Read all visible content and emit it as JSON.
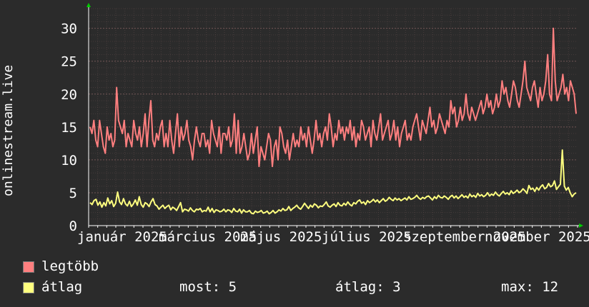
{
  "chart_data": {
    "type": "line",
    "ylabel": "onlinestream.live",
    "ylim": [
      0,
      33
    ],
    "y_ticks": [
      0,
      5,
      10,
      15,
      20,
      25,
      30
    ],
    "x_tick_labels": [
      "január 2025",
      "március 2025",
      "május 2025",
      "július 2025",
      "szeptember 2025",
      "november 2025"
    ],
    "grid": true,
    "legend_placement": "bottom-left",
    "colors": {
      "background": "#2b2b2b",
      "plot_background": "#2b2b2b",
      "grid": "#5a4848",
      "axis": "#ffffff",
      "arrow": "#00cc00",
      "max_series": "#ff7f7f",
      "avg_series": "#ffff7f"
    },
    "series": [
      {
        "name": "legtöbb",
        "values": [
          15,
          14,
          16,
          13,
          12,
          16,
          14,
          12,
          11,
          15,
          13,
          14,
          12,
          13,
          21,
          16,
          15,
          14,
          16,
          12,
          14,
          13,
          12,
          16,
          14,
          13,
          15,
          12,
          14,
          17,
          12,
          16,
          19,
          13,
          12,
          14,
          13,
          15,
          16,
          12,
          14,
          12,
          16,
          13,
          11,
          14,
          17,
          12,
          15,
          13,
          14,
          16,
          13,
          12,
          10,
          13,
          15,
          13,
          12,
          14,
          14,
          12,
          13,
          11,
          16,
          14,
          13,
          12,
          15,
          11,
          14,
          14,
          13,
          15,
          12,
          13,
          17,
          11,
          16,
          11,
          12,
          14,
          12,
          10,
          11,
          14,
          11,
          13,
          15,
          9,
          12,
          11,
          10,
          12,
          14,
          13,
          9,
          12,
          13,
          10,
          15,
          14,
          12,
          11,
          13,
          10,
          12,
          14,
          12,
          13,
          12,
          15,
          13,
          14,
          12,
          15,
          13,
          11,
          13,
          16,
          13,
          14,
          12,
          14,
          15,
          13,
          17,
          15,
          12,
          14,
          13,
          16,
          14,
          15,
          13,
          15,
          14,
          16,
          13,
          15,
          12,
          14,
          13,
          16,
          15,
          13,
          14,
          15,
          12,
          16,
          14,
          13,
          15,
          17,
          13,
          14,
          15,
          16,
          13,
          14,
          16,
          13,
          15,
          12,
          14,
          15,
          16,
          13,
          14,
          13,
          15,
          16,
          17,
          15,
          13,
          16,
          15,
          14,
          16,
          18,
          15,
          16,
          14,
          15,
          17,
          16,
          15,
          14,
          16,
          15,
          19,
          17,
          18,
          15,
          16,
          18,
          16,
          17,
          20,
          17,
          16,
          18,
          17,
          16,
          17,
          18,
          19,
          17,
          18,
          20,
          18,
          19,
          17,
          18,
          20,
          18,
          19,
          22,
          20,
          21,
          19,
          18,
          20,
          22,
          21,
          19,
          18,
          20,
          22,
          25,
          21,
          20,
          19,
          21,
          22,
          20,
          18,
          21,
          19,
          20,
          22,
          26,
          20,
          19,
          30,
          22,
          19,
          20,
          21,
          23,
          20,
          21,
          19,
          22,
          21,
          20,
          17
        ],
        "legend_label": "legtöbb"
      },
      {
        "name": "átlag",
        "values": [
          3.5,
          3.2,
          3.8,
          4,
          3.1,
          3.6,
          2.8,
          3.5,
          3,
          4.2,
          3.3,
          3.8,
          2.9,
          3.4,
          5.1,
          3.6,
          3.2,
          4.1,
          3.3,
          3,
          3.7,
          2.9,
          3.3,
          3.9,
          3.1,
          4.4,
          3.2,
          2.8,
          3.5,
          3.3,
          2.9,
          3.6,
          4.1,
          3.2,
          3,
          2.5,
          2.8,
          3.1,
          2.6,
          2.9,
          3.1,
          2.4,
          2.8,
          2.6,
          2.3,
          2.9,
          3.5,
          2.1,
          2.5,
          2.4,
          2.2,
          2.7,
          2.3,
          2.1,
          2.5,
          2.4,
          2.6,
          2.1,
          2.3,
          2.2,
          2.8,
          2.1,
          2.6,
          2,
          2.4,
          2.3,
          2.1,
          2.2,
          2.5,
          2.1,
          2.4,
          2.3,
          2,
          2.6,
          2.2,
          2.1,
          2.5,
          1.9,
          2.4,
          2.1,
          2.1,
          2.3,
          1.9,
          1.8,
          2.2,
          2,
          2.1,
          2.3,
          1.9,
          2,
          2.2,
          1.8,
          2,
          2.3,
          1.9,
          2.1,
          2.4,
          2.2,
          2.6,
          2.3,
          2.4,
          2.9,
          2.3,
          2.6,
          2.8,
          3.1,
          2.7,
          2.5,
          2.9,
          3.4,
          3,
          2.6,
          3.1,
          2.8,
          3.3,
          3.1,
          2.7,
          3,
          2.9,
          3.2,
          3.6,
          3,
          2.8,
          3.1,
          3.3,
          2.9,
          3.5,
          3.1,
          3,
          3.4,
          3.1,
          3.6,
          3.2,
          3,
          3.5,
          3.3,
          3.7,
          3.9,
          3.4,
          3.6,
          3.2,
          3.8,
          3.5,
          3.7,
          4,
          3.6,
          3.9,
          3.5,
          3.8,
          4.1,
          3.7,
          3.9,
          4.3,
          4,
          3.8,
          4.2,
          3.9,
          4.1,
          3.8,
          4,
          4.2,
          3.9,
          4.4,
          4,
          4.1,
          4.3,
          4.6,
          4.2,
          4,
          4.3,
          4.1,
          4.4,
          4.5,
          4.2,
          3.9,
          4.4,
          4.1,
          4.6,
          4.3,
          4.2,
          4.5,
          4.3,
          4,
          4.4,
          4.6,
          4.2,
          4.5,
          4.1,
          4.4,
          4.7,
          4.3,
          4.5,
          4.2,
          4.8,
          4.4,
          4.6,
          4.3,
          4.9,
          4.5,
          4.7,
          4.4,
          4.6,
          5,
          4.5,
          4.8,
          4.6,
          5.1,
          4.7,
          4.5,
          4.9,
          5.2,
          4.8,
          5,
          4.7,
          5.3,
          4.9,
          5.1,
          5.4,
          5,
          5.2,
          5.6,
          5.3,
          4.9,
          6.1,
          5.5,
          5.7,
          5.2,
          5.8,
          5.4,
          5.9,
          6.2,
          5.6,
          5.8,
          6.4,
          5.9,
          6.1,
          6.8,
          5.5,
          5.9,
          6.3,
          11.5,
          6,
          5.4,
          5.8,
          5,
          4.4,
          4.8,
          5
        ],
        "legend_label": "átlag"
      }
    ],
    "stats": {
      "now_label": "most:",
      "now_value": "5",
      "avg_label": "átlag:",
      "avg_value": "3",
      "max_label": "max:",
      "max_value": "12"
    }
  }
}
